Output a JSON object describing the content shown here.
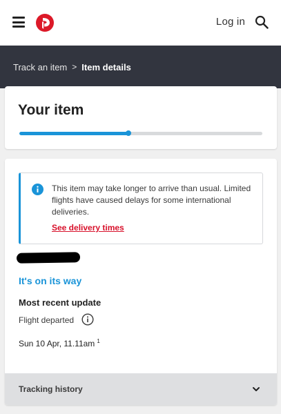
{
  "header": {
    "login_label": "Log in",
    "brand_color": "#dc1928",
    "icons": {
      "menu": "hamburger-menu-icon",
      "logo": "auspost-logo-icon",
      "search": "search-icon"
    }
  },
  "breadcrumb": {
    "items": [
      "Track an item",
      "Item details"
    ],
    "separator": ">"
  },
  "item_card": {
    "title": "Your item",
    "progress_fraction": 0.45,
    "progress_color": "#1a94d8"
  },
  "notice": {
    "text": "This item may take longer to arrive than usual. Limited flights have caused delays for some international deliveries.",
    "link_label": "See delivery times",
    "icon": "info-icon"
  },
  "tracking": {
    "status": "It's on its way",
    "recent_heading": "Most recent update",
    "event_label": "Flight departed",
    "event_time": "Sun 10 Apr, 11.11am",
    "event_footnote": "1"
  },
  "history": {
    "label": "Tracking history",
    "icon": "chevron-down-icon"
  }
}
